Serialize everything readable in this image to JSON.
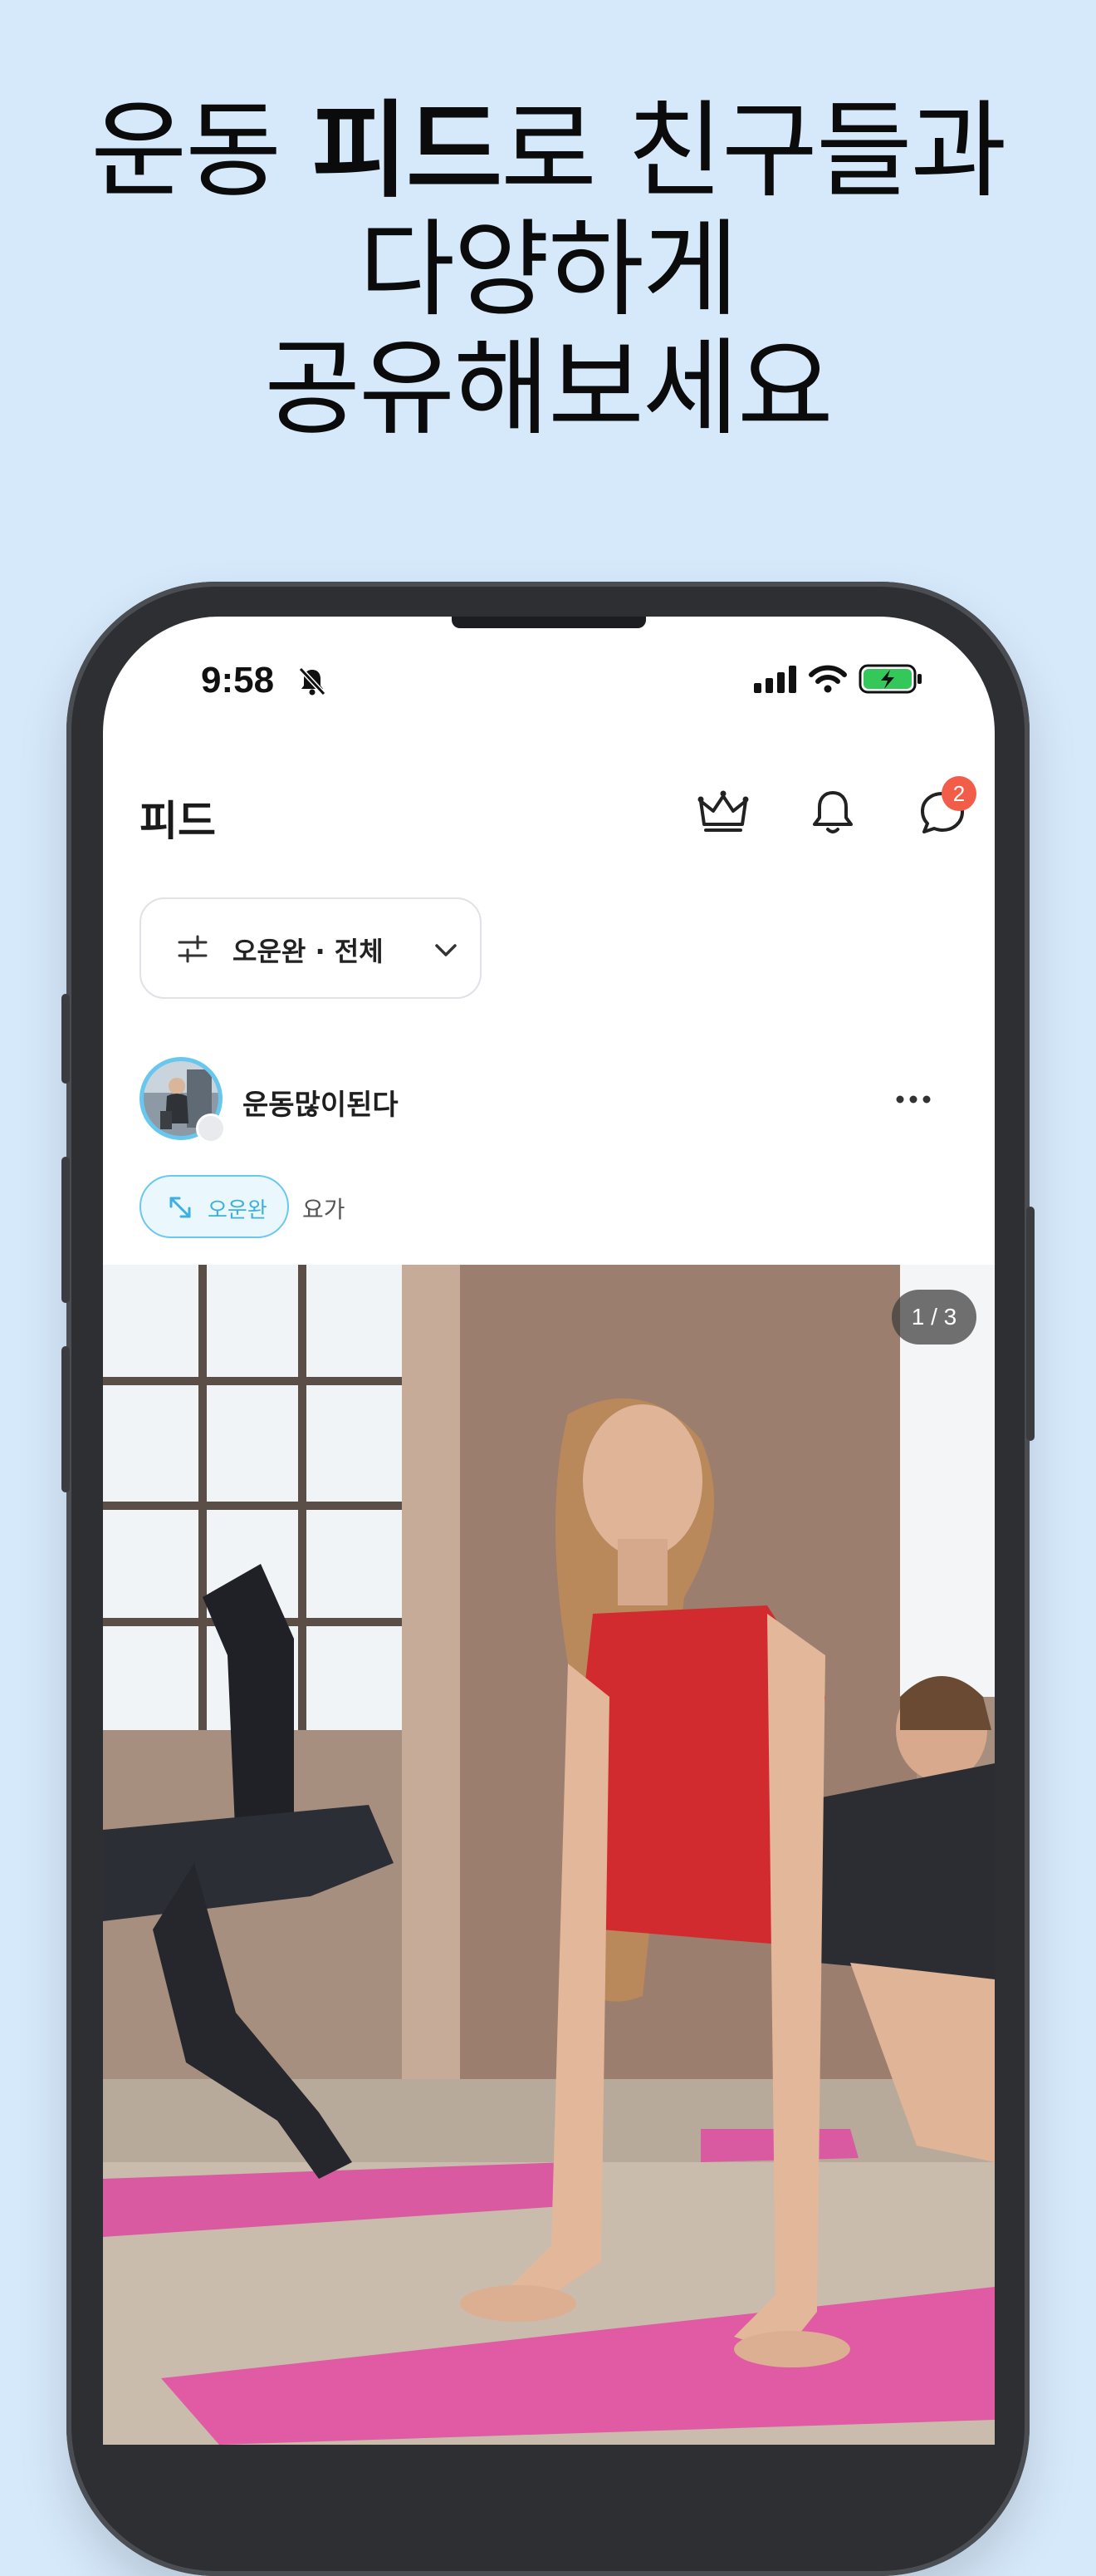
{
  "headline": {
    "line1_pre": "운동 ",
    "line1_bold": "피드",
    "line1_post": "로 친구들과",
    "line2": "다양하게",
    "line3": "공유해보세요"
  },
  "status_bar": {
    "time": "9:58",
    "icons": [
      "bell-slash-icon",
      "cellular-signal-icon",
      "wifi-icon",
      "battery-charging-icon"
    ],
    "battery_color": "#34c759"
  },
  "header": {
    "title": "피드",
    "icons": [
      "crown-icon",
      "bell-icon",
      "chat-icon"
    ],
    "chat_badge_count": "2",
    "badge_color": "#f25d4a"
  },
  "filter": {
    "icon": "sliders-icon",
    "label": "오운완 · 전체"
  },
  "post": {
    "username": "운동많이된다",
    "avatar_ring_color": "#66c8ef",
    "tag_chip_label": "오운완",
    "tag_chip_icon": "expand-arrows-icon",
    "tag_text": "요가",
    "page_indicator": "1 / 3",
    "accent_color": "#3dafe0"
  }
}
